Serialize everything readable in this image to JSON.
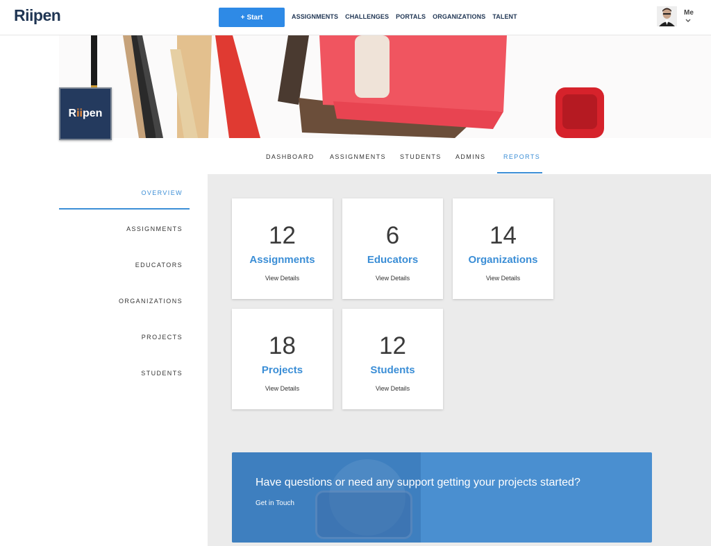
{
  "header": {
    "logo": "Riipen",
    "start_label": "Start",
    "nav": [
      "ASSIGNMENTS",
      "CHALLENGES",
      "PORTALS",
      "ORGANIZATIONS",
      "TALENT"
    ],
    "user_label": "Me"
  },
  "org": {
    "logo_text_a": "R",
    "logo_text_b": "ii",
    "logo_text_c": "pen"
  },
  "tabs": [
    "DASHBOARD",
    "ASSIGNMENTS",
    "STUDENTS",
    "ADMINS",
    "REPORTS"
  ],
  "active_tab": "REPORTS",
  "sidebar": [
    "OVERVIEW",
    "ASSIGNMENTS",
    "EDUCATORS",
    "ORGANIZATIONS",
    "PROJECTS",
    "STUDENTS"
  ],
  "active_sidebar": "OVERVIEW",
  "cards": [
    {
      "count": "12",
      "label": "Assignments",
      "link": "View Details"
    },
    {
      "count": "6",
      "label": "Educators",
      "link": "View Details"
    },
    {
      "count": "14",
      "label": "Organizations",
      "link": "View Details"
    },
    {
      "count": "18",
      "label": "Projects",
      "link": "View Details"
    },
    {
      "count": "12",
      "label": "Students",
      "link": "View Details"
    }
  ],
  "support": {
    "question": "Have questions or need any support getting your projects started?",
    "link": "Get in Touch"
  },
  "colors": {
    "accent": "#3b8ed6",
    "button": "#2e8ae6",
    "navy": "#1f3553",
    "orange": "#e7893b"
  }
}
